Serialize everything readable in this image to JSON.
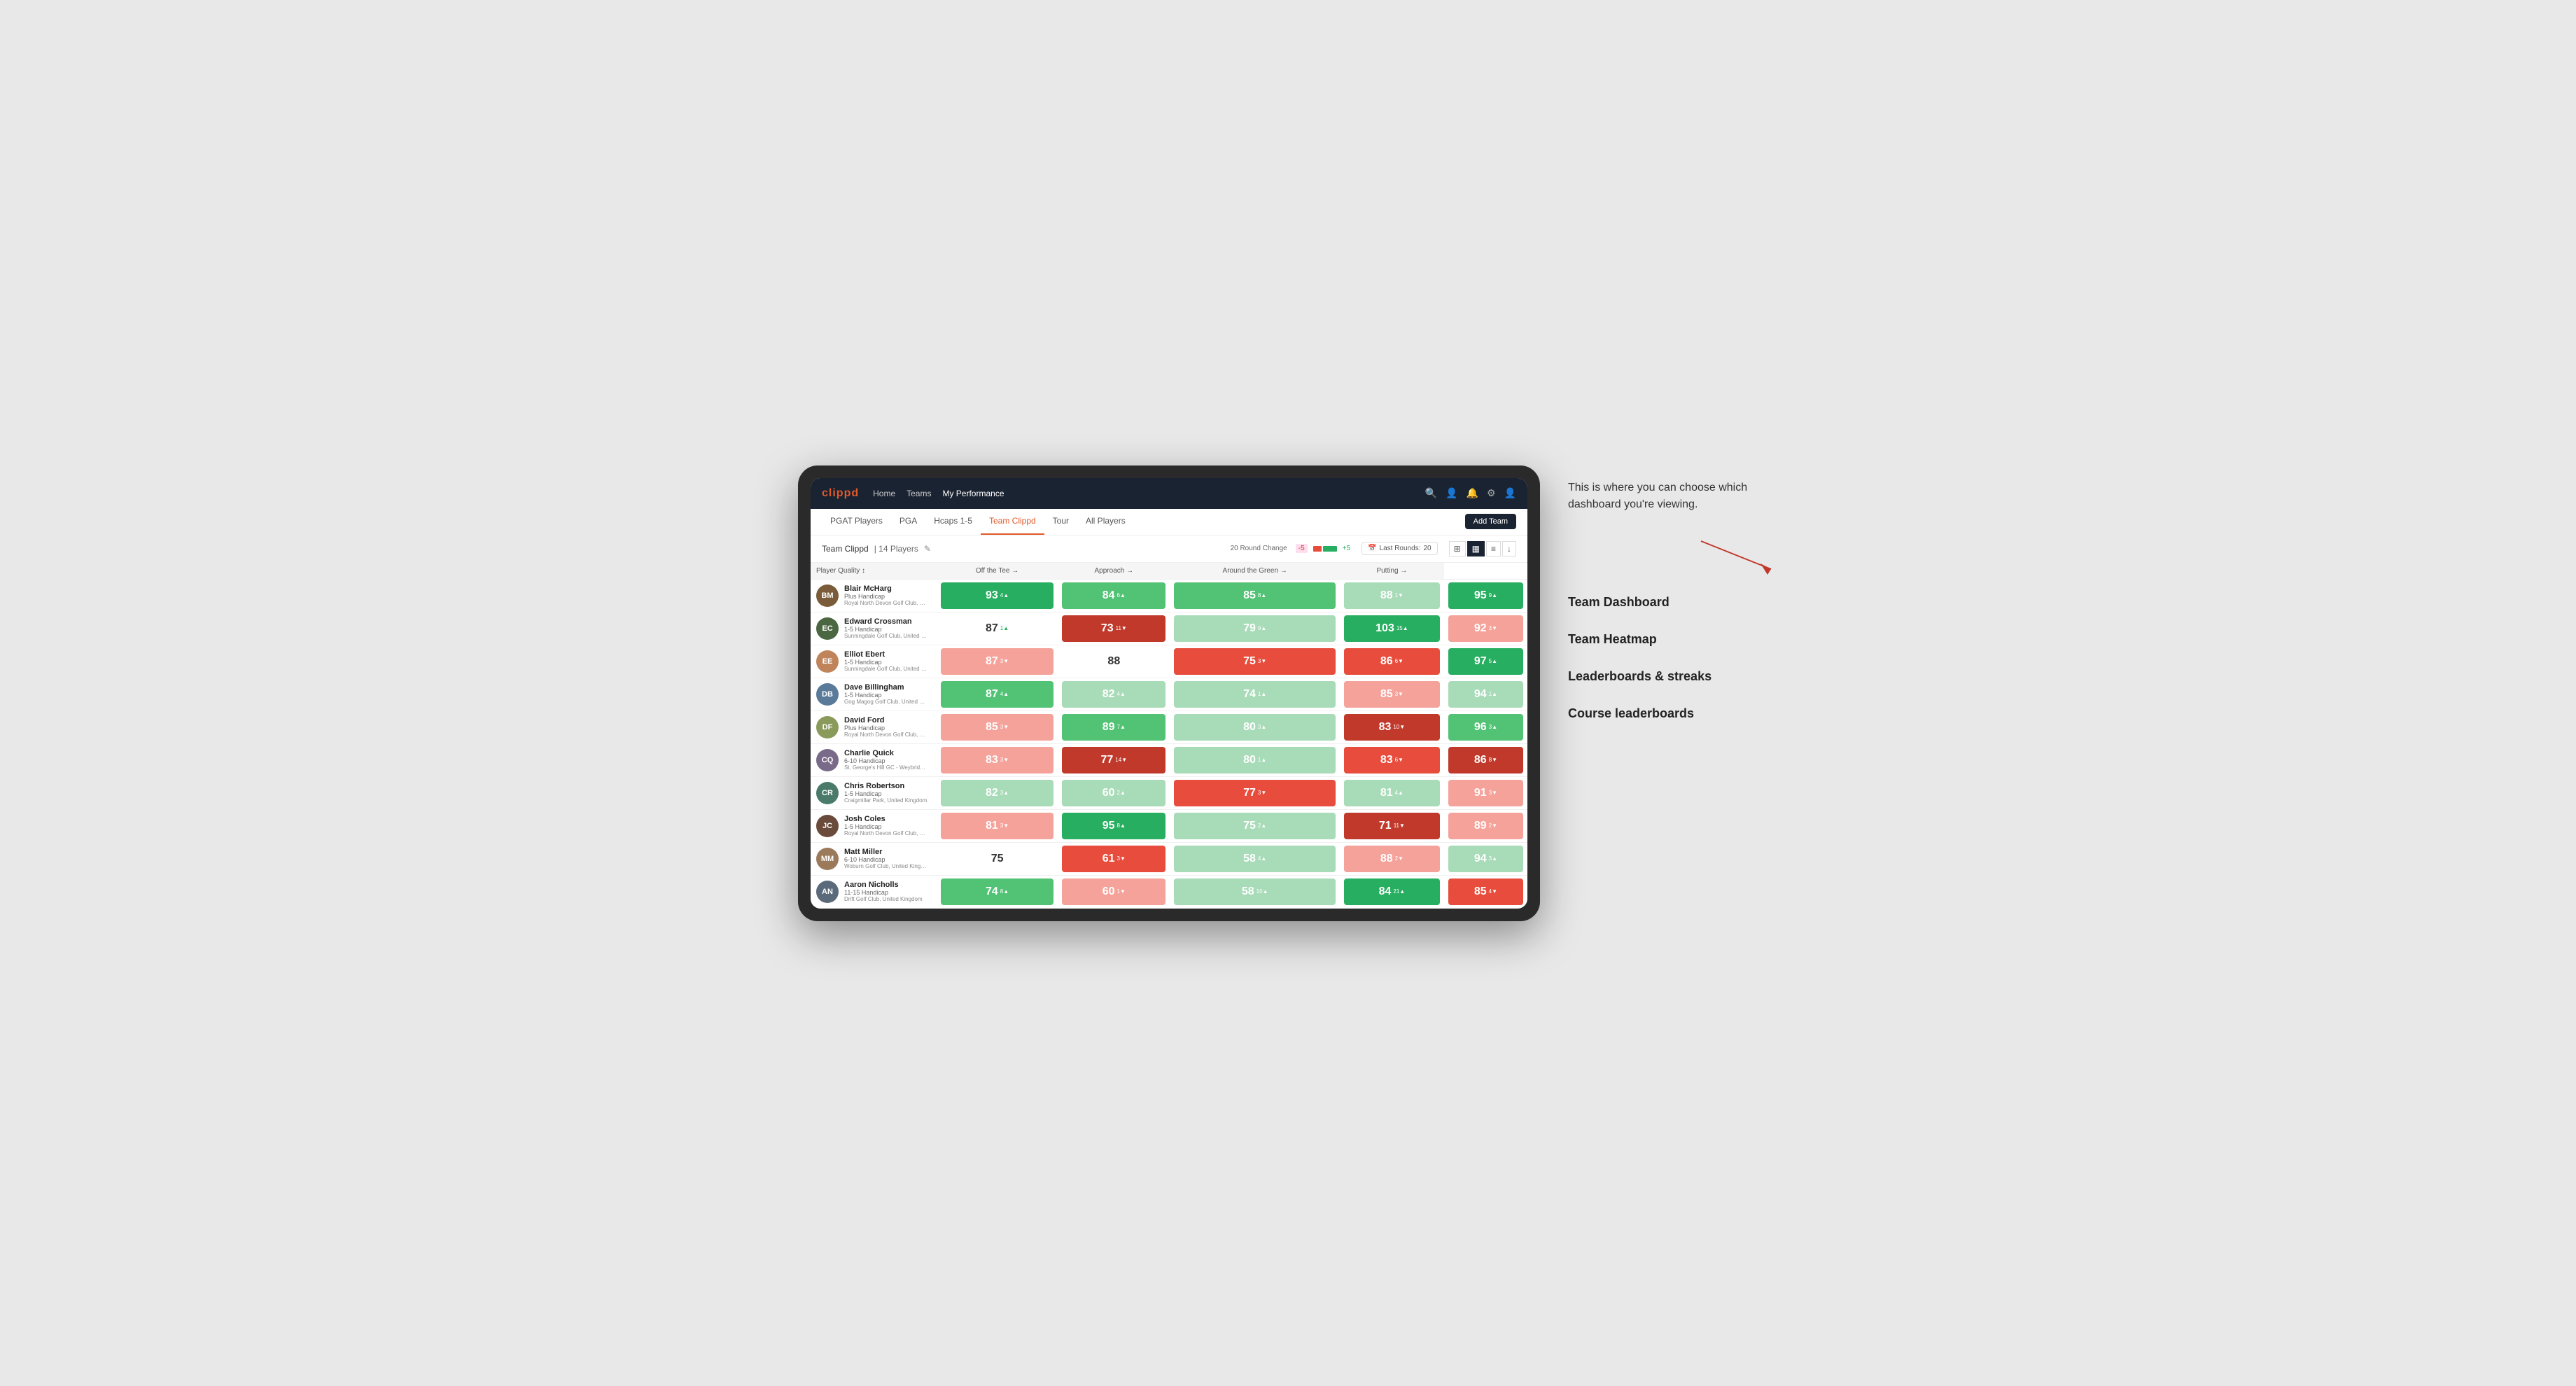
{
  "annotation": {
    "intro": "This is where you can choose which dashboard you're viewing.",
    "items": [
      "Team Dashboard",
      "Team Heatmap",
      "Leaderboards & streaks",
      "Course leaderboards"
    ]
  },
  "nav": {
    "logo": "clippd",
    "links": [
      "Home",
      "Teams",
      "My Performance"
    ],
    "active_link": "My Performance"
  },
  "sub_nav": {
    "links": [
      "PGAT Players",
      "PGA",
      "Hcaps 1-5",
      "Team Clippd",
      "Tour",
      "All Players"
    ],
    "active_link": "Team Clippd",
    "add_team": "Add Team"
  },
  "team_header": {
    "title": "Team Clippd",
    "separator": "|",
    "count": "14 Players",
    "round_change_label": "20 Round Change",
    "round_change_neg": "-5",
    "round_change_pos": "+5",
    "last_rounds_label": "Last Rounds:",
    "last_rounds_value": "20"
  },
  "table": {
    "columns": {
      "player": "Player Quality",
      "off_tee": "Off the Tee",
      "approach": "Approach",
      "around_green": "Around the Green",
      "putting": "Putting"
    },
    "players": [
      {
        "name": "Blair McHarg",
        "handicap": "Plus Handicap",
        "club": "Royal North Devon Golf Club, United Kingdom",
        "initials": "BM",
        "avatar_color": "#7a5c3a",
        "metrics": {
          "quality": {
            "value": 93,
            "change": 4,
            "dir": "up",
            "color": "green-strong"
          },
          "off_tee": {
            "value": 84,
            "change": 6,
            "dir": "up",
            "color": "green-mid"
          },
          "approach": {
            "value": 85,
            "change": 8,
            "dir": "up",
            "color": "green-mid"
          },
          "around_green": {
            "value": 88,
            "change": 1,
            "dir": "down",
            "color": "green-light"
          },
          "putting": {
            "value": 95,
            "change": 9,
            "dir": "up",
            "color": "green-strong"
          }
        }
      },
      {
        "name": "Edward Crossman",
        "handicap": "1-5 Handicap",
        "club": "Sunningdale Golf Club, United Kingdom",
        "initials": "EC",
        "avatar_color": "#4a6741",
        "metrics": {
          "quality": {
            "value": 87,
            "change": 1,
            "dir": "up",
            "color": "none"
          },
          "off_tee": {
            "value": 73,
            "change": 11,
            "dir": "down",
            "color": "red-strong"
          },
          "approach": {
            "value": 79,
            "change": 9,
            "dir": "up",
            "color": "green-light"
          },
          "around_green": {
            "value": 103,
            "change": 15,
            "dir": "up",
            "color": "green-strong"
          },
          "putting": {
            "value": 92,
            "change": 3,
            "dir": "down",
            "color": "red-light"
          }
        }
      },
      {
        "name": "Elliot Ebert",
        "handicap": "1-5 Handicap",
        "club": "Sunningdale Golf Club, United Kingdom",
        "initials": "EE",
        "avatar_color": "#c0845a",
        "metrics": {
          "quality": {
            "value": 87,
            "change": 3,
            "dir": "down",
            "color": "red-light"
          },
          "off_tee": {
            "value": 88,
            "change": 0,
            "dir": "none",
            "color": "none"
          },
          "approach": {
            "value": 75,
            "change": 3,
            "dir": "down",
            "color": "red-mid"
          },
          "around_green": {
            "value": 86,
            "change": 6,
            "dir": "down",
            "color": "red-mid"
          },
          "putting": {
            "value": 97,
            "change": 5,
            "dir": "up",
            "color": "green-strong"
          }
        }
      },
      {
        "name": "Dave Billingham",
        "handicap": "1-5 Handicap",
        "club": "Gog Magog Golf Club, United Kingdom",
        "initials": "DB",
        "avatar_color": "#5a7a9a",
        "metrics": {
          "quality": {
            "value": 87,
            "change": 4,
            "dir": "up",
            "color": "green-mid"
          },
          "off_tee": {
            "value": 82,
            "change": 4,
            "dir": "up",
            "color": "green-light"
          },
          "approach": {
            "value": 74,
            "change": 1,
            "dir": "up",
            "color": "green-light"
          },
          "around_green": {
            "value": 85,
            "change": 3,
            "dir": "down",
            "color": "red-light"
          },
          "putting": {
            "value": 94,
            "change": 1,
            "dir": "up",
            "color": "green-light"
          }
        }
      },
      {
        "name": "David Ford",
        "handicap": "Plus Handicap",
        "club": "Royal North Devon Golf Club, United Kingdom",
        "initials": "DF",
        "avatar_color": "#8a9a5a",
        "metrics": {
          "quality": {
            "value": 85,
            "change": 3,
            "dir": "down",
            "color": "red-light"
          },
          "off_tee": {
            "value": 89,
            "change": 7,
            "dir": "up",
            "color": "green-mid"
          },
          "approach": {
            "value": 80,
            "change": 3,
            "dir": "up",
            "color": "green-light"
          },
          "around_green": {
            "value": 83,
            "change": 10,
            "dir": "down",
            "color": "red-strong"
          },
          "putting": {
            "value": 96,
            "change": 3,
            "dir": "up",
            "color": "green-mid"
          }
        }
      },
      {
        "name": "Charlie Quick",
        "handicap": "6-10 Handicap",
        "club": "St. George's Hill GC - Weybridge - Surrey, Uni...",
        "initials": "CQ",
        "avatar_color": "#7a6a8a",
        "metrics": {
          "quality": {
            "value": 83,
            "change": 3,
            "dir": "down",
            "color": "red-light"
          },
          "off_tee": {
            "value": 77,
            "change": 14,
            "dir": "down",
            "color": "red-strong"
          },
          "approach": {
            "value": 80,
            "change": 1,
            "dir": "up",
            "color": "green-light"
          },
          "around_green": {
            "value": 83,
            "change": 6,
            "dir": "down",
            "color": "red-mid"
          },
          "putting": {
            "value": 86,
            "change": 8,
            "dir": "down",
            "color": "red-strong"
          }
        }
      },
      {
        "name": "Chris Robertson",
        "handicap": "1-5 Handicap",
        "club": "Craigmillar Park, United Kingdom",
        "initials": "CR",
        "avatar_color": "#4a7a6a",
        "metrics": {
          "quality": {
            "value": 82,
            "change": 3,
            "dir": "up",
            "color": "green-light"
          },
          "off_tee": {
            "value": 60,
            "change": 2,
            "dir": "up",
            "color": "green-light"
          },
          "approach": {
            "value": 77,
            "change": 3,
            "dir": "down",
            "color": "red-mid"
          },
          "around_green": {
            "value": 81,
            "change": 4,
            "dir": "up",
            "color": "green-light"
          },
          "putting": {
            "value": 91,
            "change": 3,
            "dir": "down",
            "color": "red-light"
          }
        }
      },
      {
        "name": "Josh Coles",
        "handicap": "1-5 Handicap",
        "club": "Royal North Devon Golf Club, United Kingdom",
        "initials": "JC",
        "avatar_color": "#6a4a3a",
        "metrics": {
          "quality": {
            "value": 81,
            "change": 3,
            "dir": "down",
            "color": "red-light"
          },
          "off_tee": {
            "value": 95,
            "change": 8,
            "dir": "up",
            "color": "green-strong"
          },
          "approach": {
            "value": 75,
            "change": 2,
            "dir": "up",
            "color": "green-light"
          },
          "around_green": {
            "value": 71,
            "change": 11,
            "dir": "down",
            "color": "red-strong"
          },
          "putting": {
            "value": 89,
            "change": 2,
            "dir": "down",
            "color": "red-light"
          }
        }
      },
      {
        "name": "Matt Miller",
        "handicap": "6-10 Handicap",
        "club": "Woburn Golf Club, United Kingdom",
        "initials": "MM",
        "avatar_color": "#9a7a5a",
        "metrics": {
          "quality": {
            "value": 75,
            "change": 0,
            "dir": "none",
            "color": "none"
          },
          "off_tee": {
            "value": 61,
            "change": 3,
            "dir": "down",
            "color": "red-mid"
          },
          "approach": {
            "value": 58,
            "change": 4,
            "dir": "up",
            "color": "green-light"
          },
          "around_green": {
            "value": 88,
            "change": 2,
            "dir": "down",
            "color": "red-light"
          },
          "putting": {
            "value": 94,
            "change": 3,
            "dir": "up",
            "color": "green-light"
          }
        }
      },
      {
        "name": "Aaron Nicholls",
        "handicap": "11-15 Handicap",
        "club": "Drift Golf Club, United Kingdom",
        "initials": "AN",
        "avatar_color": "#5a6a7a",
        "metrics": {
          "quality": {
            "value": 74,
            "change": 8,
            "dir": "up",
            "color": "green-mid"
          },
          "off_tee": {
            "value": 60,
            "change": 1,
            "dir": "down",
            "color": "red-light"
          },
          "approach": {
            "value": 58,
            "change": 10,
            "dir": "up",
            "color": "green-light"
          },
          "around_green": {
            "value": 84,
            "change": 21,
            "dir": "up",
            "color": "green-strong"
          },
          "putting": {
            "value": 85,
            "change": 4,
            "dir": "down",
            "color": "red-mid"
          }
        }
      }
    ]
  }
}
